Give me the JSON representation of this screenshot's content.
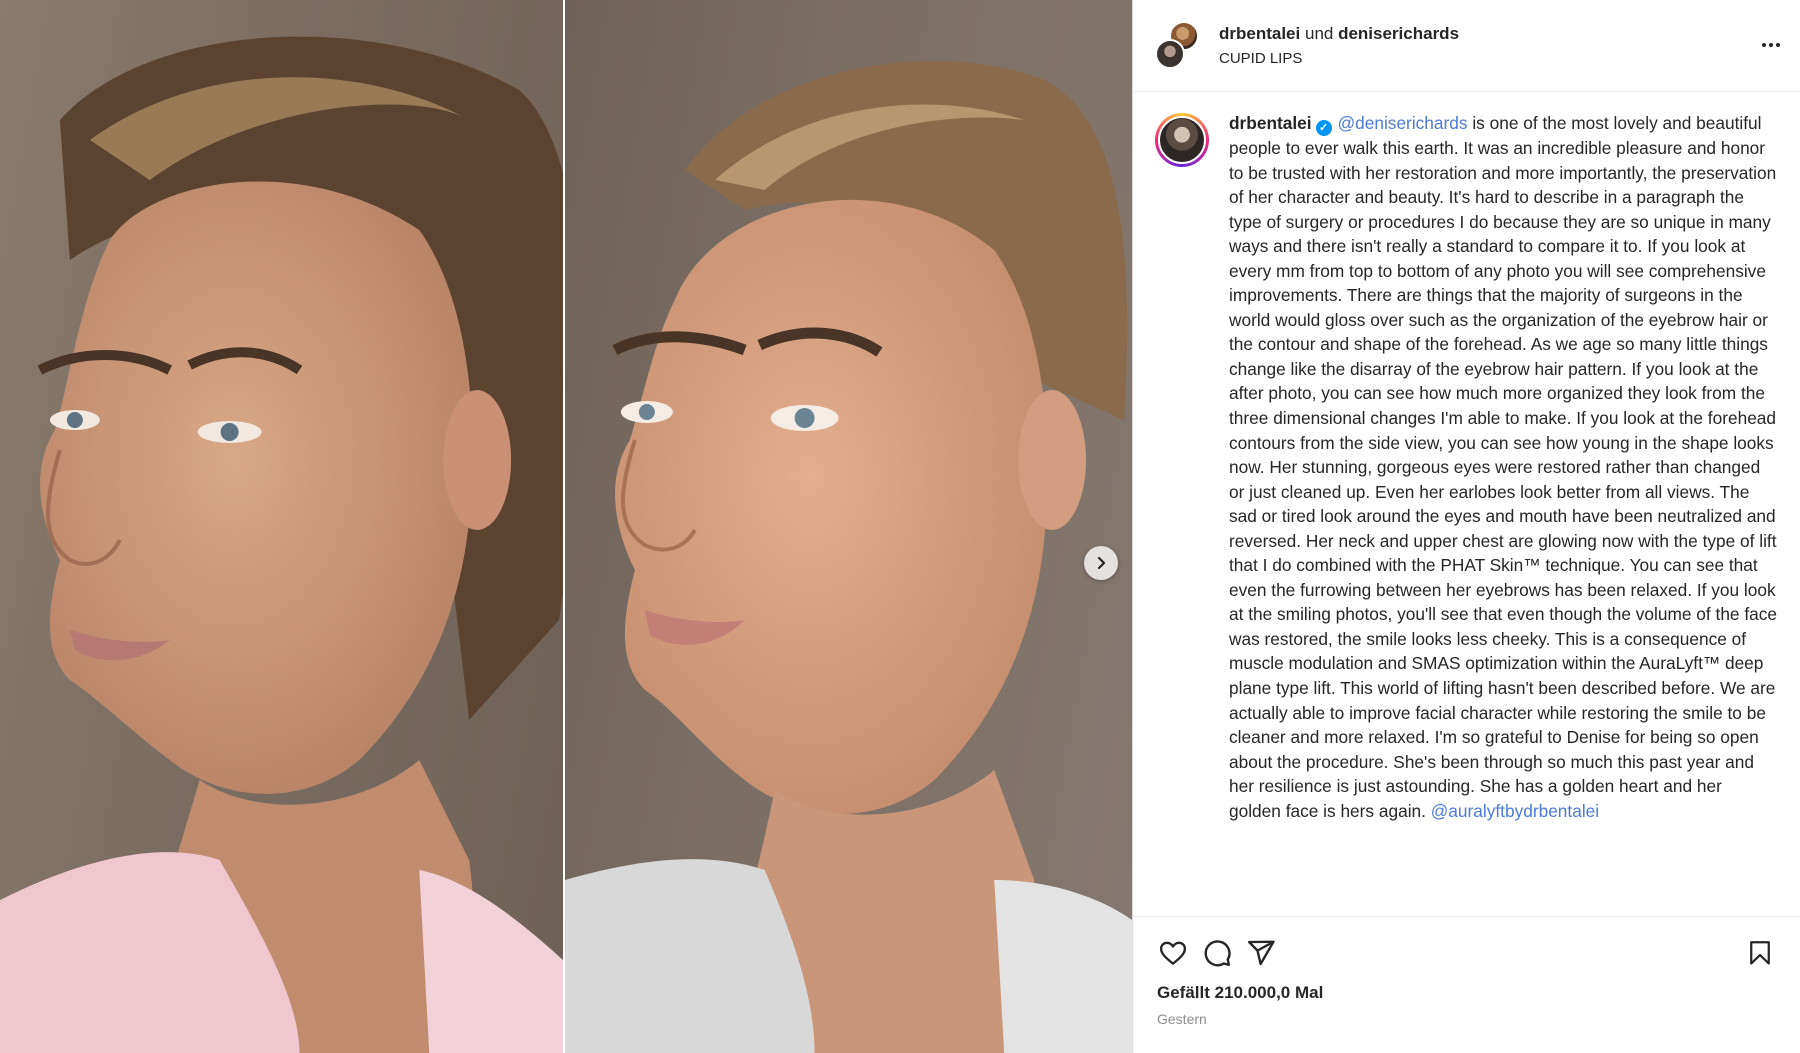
{
  "header": {
    "user1": "drbentalei",
    "joiner": "und",
    "user2": "deniserichards",
    "subtitle": "CUPID LIPS"
  },
  "caption": {
    "username": "drbentalei",
    "mention": "@deniserichards",
    "text": " is one of the most lovely and beautiful people to ever walk this earth. It was an incredible pleasure and honor to be trusted with her restoration and more importantly, the preservation of her character and beauty. It's hard to describe in a paragraph the type of surgery or procedures I do because they are so unique in many ways and there isn't really a standard to compare it to. If you look at every mm from top to bottom of any photo you will see comprehensive improvements. There are things that the majority of surgeons in the world would gloss over such as the organization of the eyebrow hair or the contour and shape of the forehead. As we age so many little things change like the disarray of the eyebrow hair pattern. If you look at the after photo, you can see how much more organized they look from the three dimensional changes I'm able to make. If you look at the forehead contours from the side view, you can see how young in the shape looks now. Her stunning, gorgeous eyes were restored rather than changed or just cleaned up. Even her earlobes look better from all views. The sad or tired look around the eyes and mouth have been neutralized and reversed. Her neck and upper chest are glowing now with the type of lift that I do combined with the PHAT Skin™ technique. You can see that even the furrowing between her eyebrows has been relaxed. If you look at the smiling photos, you'll see that even though the volume of the face was restored, the smile looks less cheeky. This is a consequence of muscle modulation and SMAS optimization within the AuraLyft™ deep plane type lift. This world of lifting hasn't been described before. We are actually able to improve facial character while restoring the smile to be cleaner and more relaxed. I'm so grateful to Denise for being so open about the procedure. She's been through so much this past year and her resilience is just astounding. She has a golden heart and her golden face is hers again. ",
    "mention2": "@auralyftbydrbentalei"
  },
  "actions": {
    "likes": "Gefällt 210.000,0 Mal",
    "date": "Gestern"
  },
  "icons": {
    "like": "heart-icon",
    "comment": "comment-icon",
    "share": "share-icon",
    "save": "bookmark-icon",
    "next": "chevron-right-icon",
    "more": "more-icon",
    "verified": "verified-icon"
  },
  "colors": {
    "mention": "#4b7bd6",
    "verified": "#0095f6",
    "text": "#262626",
    "secondary": "#8e8e8e"
  }
}
